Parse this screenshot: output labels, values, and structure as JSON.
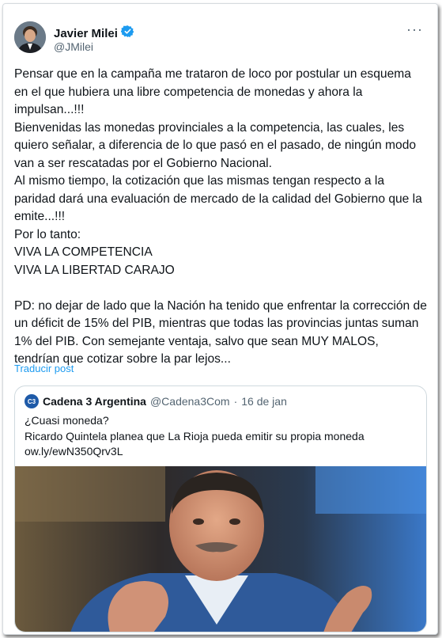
{
  "author": {
    "name": "Javier Milei",
    "handle": "@JMilei",
    "verified": true
  },
  "more_button": "···",
  "post": {
    "text": "Pensar que en la campaña me trataron de loco por postular un esquema en el que hubiera una libre competencia de monedas y ahora la impulsan...!!!\nBienvenidas las monedas provinciales a la competencia, las cuales, les quiero señalar, a diferencia de lo que pasó en el pasado, de ningún modo van a ser rescatadas por el Gobierno Nacional.\nAl mismo tiempo, la cotización que las mismas tengan respecto a la paridad dará una evaluación de mercado de la calidad del Gobierno que la emite...!!!\nPor lo tanto:\nVIVA LA COMPETENCIA\nVIVA LA LIBERTAD CARAJO\n\nPD: no dejar de lado que la Nación ha tenido que enfrentar la corrección de un déficit de 15% del PIB, mientras que todas las provincias juntas suman 1% del PIB. Con semejante ventaja, salvo que sean MUY MALOS, tendrían que cotizar sobre la par lejos..."
  },
  "translate_link": "Traducir post",
  "quoted": {
    "logo_text": "C3",
    "name": "Cadena 3 Argentina",
    "handle": "@Cadena3Com",
    "separator": "·",
    "date": "16 de jan",
    "line1": "¿Cuasi moneda?",
    "line2": "Ricardo Quintela planea que La Rioja pueda emitir su propia moneda",
    "line3": "ow.ly/ewN350Qrv3L"
  },
  "colors": {
    "link": "#1d9bf0",
    "verified": "#1d9bf0",
    "secondary_text": "#536471"
  }
}
